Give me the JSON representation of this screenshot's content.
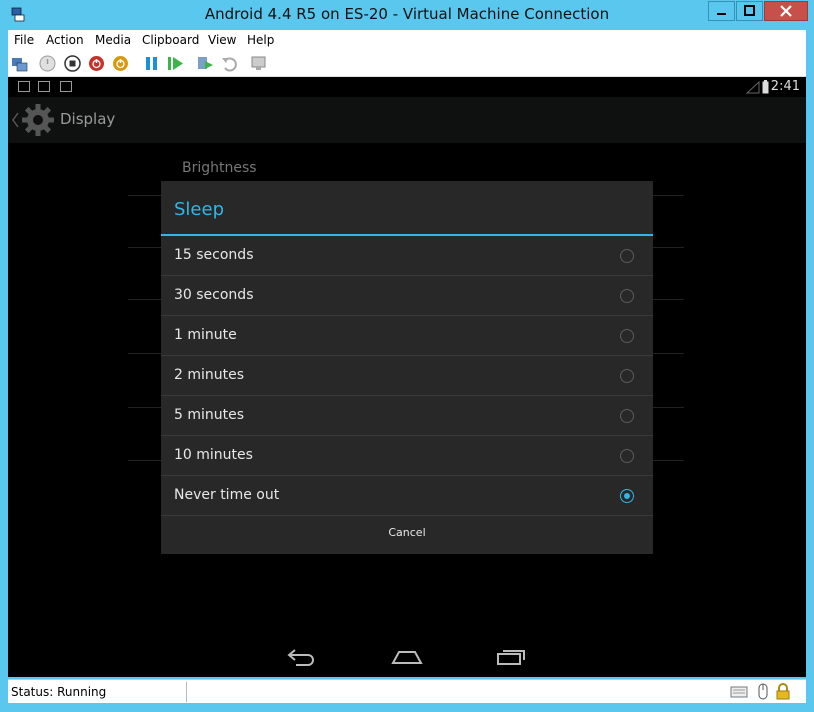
{
  "window": {
    "title": "Android 4.4 R5 on ES-20 - Virtual Machine Connection"
  },
  "menubar": {
    "items": [
      "File",
      "Action",
      "Media",
      "Clipboard",
      "View",
      "Help"
    ]
  },
  "toolbar": {
    "icons": [
      "ctrl-alt-del-icon",
      "start-icon",
      "turn-off-icon",
      "shutdown-icon",
      "save-icon",
      "pause-icon",
      "resume-icon",
      "checkpoint-icon",
      "revert-icon",
      "enhanced-session-icon"
    ]
  },
  "android": {
    "clock": "2:41",
    "actionbar_title": "Display",
    "background_item": "Brightness"
  },
  "dialog": {
    "title": "Sleep",
    "options": [
      {
        "label": "15 seconds",
        "selected": false
      },
      {
        "label": "30 seconds",
        "selected": false
      },
      {
        "label": "1 minute",
        "selected": false
      },
      {
        "label": "2 minutes",
        "selected": false
      },
      {
        "label": "5 minutes",
        "selected": false
      },
      {
        "label": "10 minutes",
        "selected": false
      },
      {
        "label": "Never time out",
        "selected": true
      }
    ],
    "cancel_label": "Cancel"
  },
  "statusbar": {
    "status": "Status: Running"
  },
  "colors": {
    "accent": "#33b5e5",
    "window_frame": "#5ac8ee",
    "dialog_bg": "#282828"
  }
}
